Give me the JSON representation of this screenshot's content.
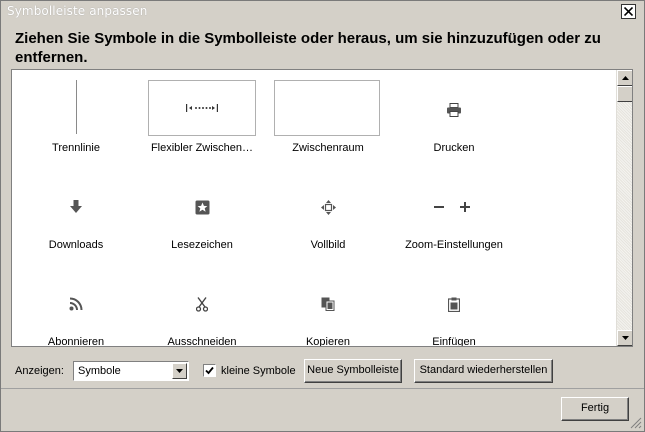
{
  "window": {
    "title": "Symbolleiste anpassen",
    "instruction": "Ziehen Sie Symbole in die Symbolleiste oder heraus, um sie hinzuzufügen oder zu entfernen."
  },
  "palette_items": [
    {
      "label": "Trennlinie",
      "icon": "separator-line-icon"
    },
    {
      "label": "Flexibler Zwischen…",
      "icon": "flexible-space-icon"
    },
    {
      "label": "Zwischenraum",
      "icon": "space-icon"
    },
    {
      "label": "Drucken",
      "icon": "printer-icon"
    },
    {
      "label": "Downloads",
      "icon": "download-arrow-icon"
    },
    {
      "label": "Lesezeichen",
      "icon": "bookmark-star-icon"
    },
    {
      "label": "Vollbild",
      "icon": "fullscreen-icon"
    },
    {
      "label": "Zoom-Einstellungen",
      "icon": "zoom-controls-icon"
    },
    {
      "label": "Abonnieren",
      "icon": "rss-feed-icon"
    },
    {
      "label": "Ausschneiden",
      "icon": "scissors-icon"
    },
    {
      "label": "Kopieren",
      "icon": "copy-icon"
    },
    {
      "label": "Einfügen",
      "icon": "paste-icon"
    }
  ],
  "controls": {
    "show_label": "Anzeigen:",
    "show_value": "Symbole",
    "small_icons_label": "kleine Symbole",
    "small_icons_checked": true,
    "new_toolbar_button": "Neue Symbolleiste",
    "restore_default_button": "Standard wiederherstellen",
    "done_button": "Fertig"
  }
}
